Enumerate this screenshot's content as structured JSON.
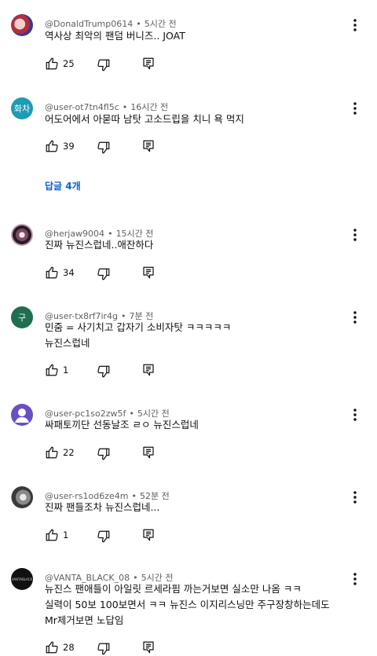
{
  "comments": [
    {
      "author": "@DonaldTrump0614",
      "time": "5시간 전",
      "text": [
        "역사상 최악의 팬덤 버니즈.. JOAT"
      ],
      "likes": "25",
      "avatar": {
        "kind": "photo",
        "color": "#c9a9b0"
      }
    },
    {
      "author": "@user-ot7tn4fl5c",
      "time": "16시간 전",
      "text": [
        "어도어에서 아묻따 남탓 고소드립을 치니 욕 먹지"
      ],
      "likes": "39",
      "avatar": {
        "kind": "letter",
        "letter": "화차",
        "color": "#1e9bb5"
      },
      "replies": "답글 4개"
    },
    {
      "author": "@herjaw9004",
      "time": "15시간 전",
      "text": [
        "진짜 뉴진스럽네..애잔하다"
      ],
      "likes": "34",
      "avatar": {
        "kind": "photo",
        "color": "#7a4a60"
      }
    },
    {
      "author": "@user-tx8rf7ir4g",
      "time": "7분 전",
      "text": [
        "민줌 = 사기치고 갑자기 소비자탓 ㅋㅋㅋㅋㅋ",
        "뉴진스럽네"
      ],
      "likes": "1",
      "avatar": {
        "kind": "letter",
        "letter": "구",
        "color": "#1f6e4f"
      }
    },
    {
      "author": "@user-pc1so2zw5f",
      "time": "5시간 전",
      "text": [
        "싸패토끼단 선동날조 ㄹㅇ 뉴진스럽네"
      ],
      "likes": "22",
      "avatar": {
        "kind": "person",
        "color": "#6a4ec4"
      }
    },
    {
      "author": "@user-rs1od6ze4m",
      "time": "52분 전",
      "text": [
        "진짜 팬들조차 뉴진스럽네..."
      ],
      "likes": "1",
      "avatar": {
        "kind": "photo",
        "color": "#8a8a8a"
      }
    },
    {
      "author": "@VANTA_BLACK_08",
      "time": "5시간 전",
      "text": [
        "뉴진스 팬애들이 아일릿 르세라핌 까는거보면 실소만 나옴 ㅋㅋ",
        "실력이 50보 100보면서 ㅋㅋ 뉴진스 이지리스닝만 주구장창하는데도",
        "Mr제거보면 노답임"
      ],
      "likes": "28",
      "avatar": {
        "kind": "logo",
        "text": "VANTABLACK",
        "color": "#111111"
      }
    }
  ]
}
